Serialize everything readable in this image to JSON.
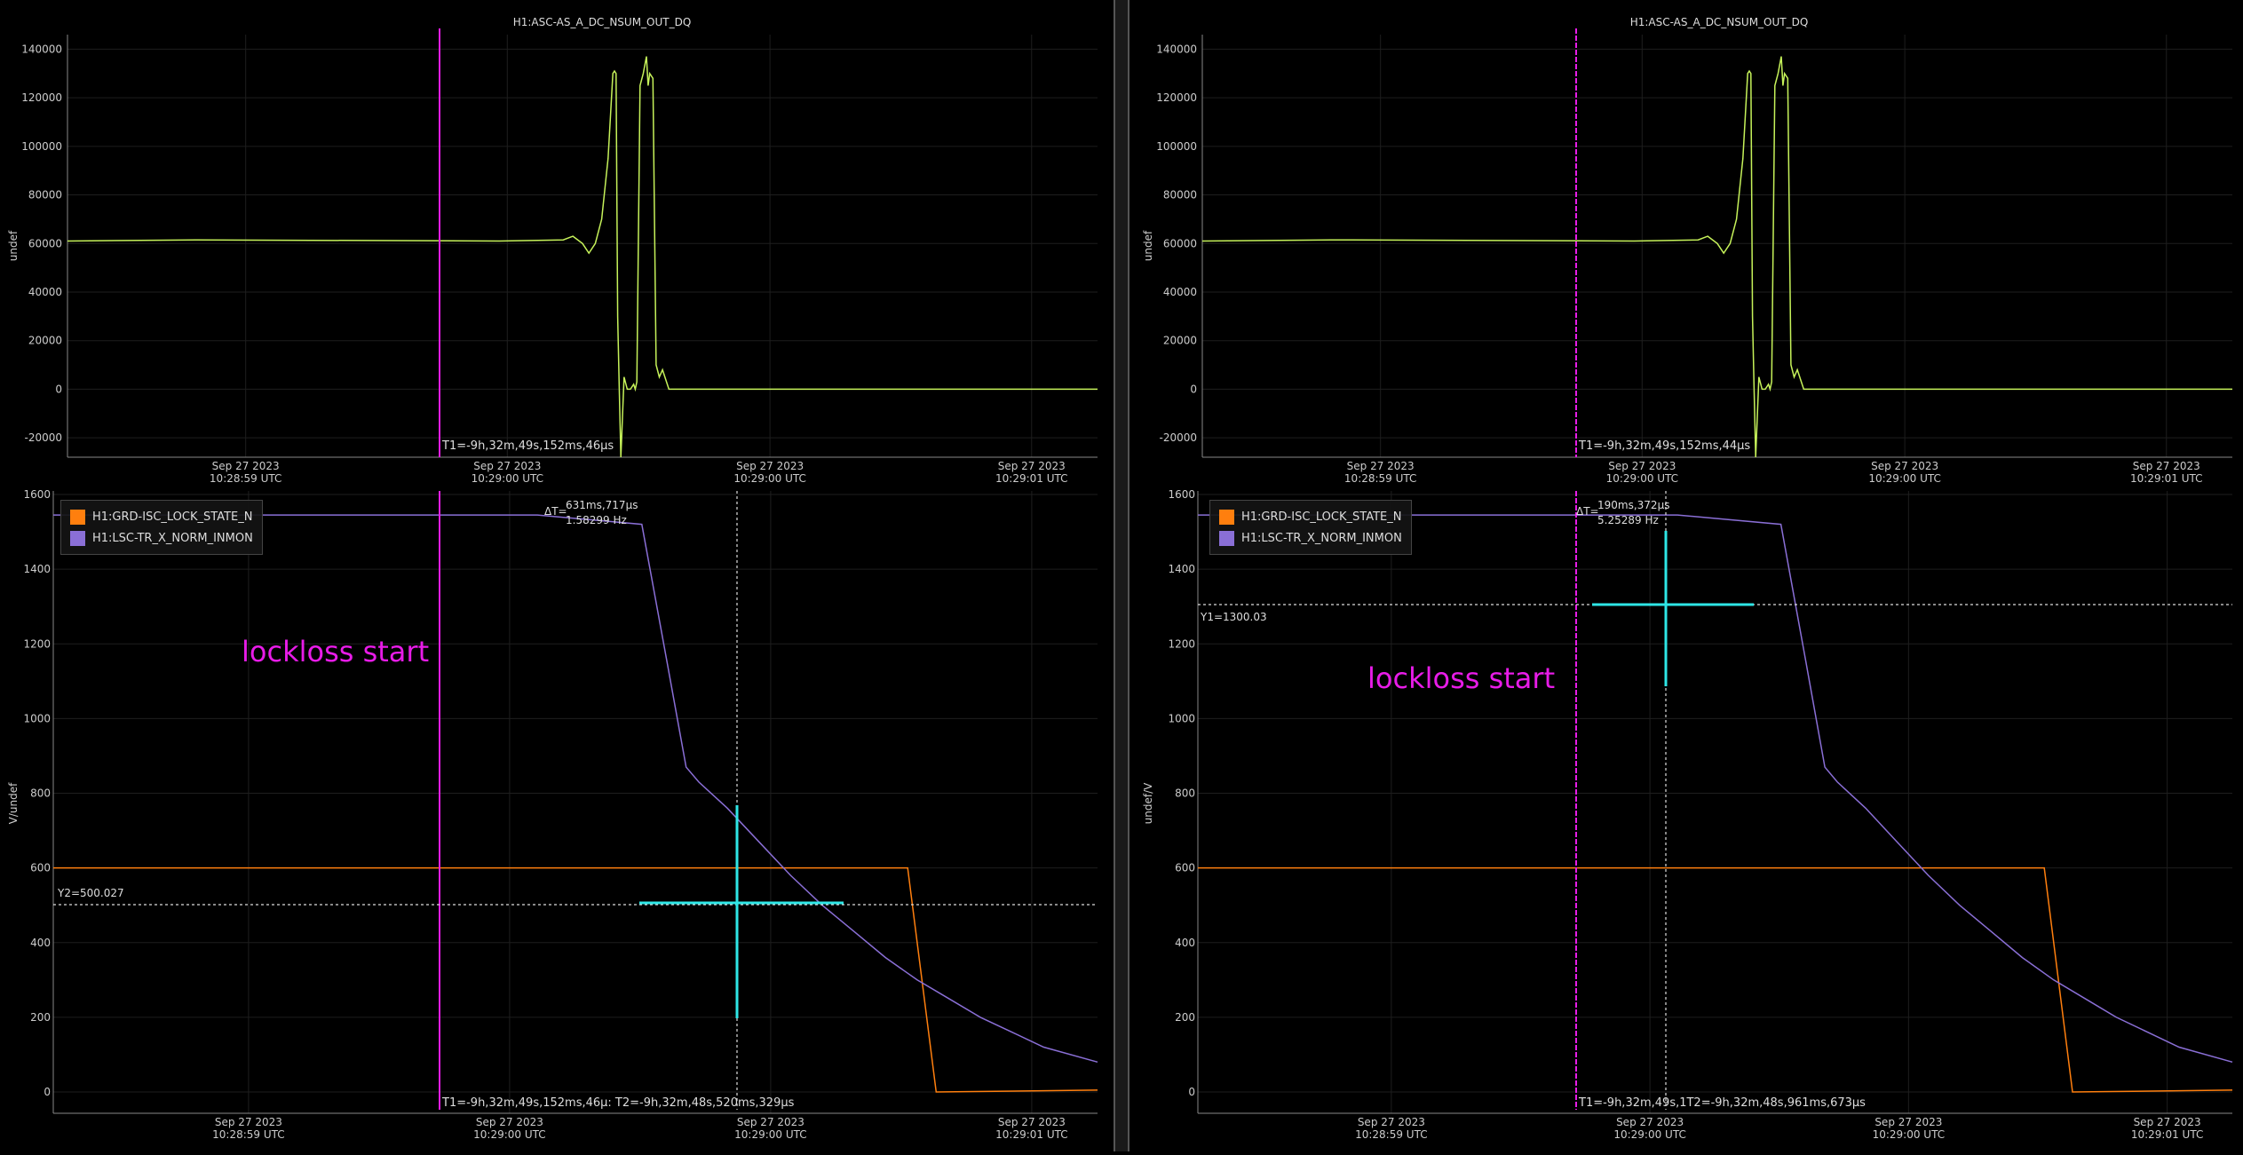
{
  "colors": {
    "green": "#c6f25a",
    "orange": "#ff7f0e",
    "purple": "#8a6fd6",
    "magenta": "#e81ce8",
    "cyan": "#2ee6e6",
    "cursor": "#dddddd"
  },
  "panels": [
    {
      "id": "left",
      "top": {
        "title": "H1:ASC-AS_A_DC_NSUM_OUT_DQ",
        "ylabel": "undef",
        "y_ticks": [
          "140000",
          "120000",
          "100000",
          "80000",
          "60000",
          "40000",
          "20000",
          "0",
          "-20000"
        ],
        "x_ticks": [
          {
            "date": "Sep 27 2023",
            "time": "10:28:59 UTC"
          },
          {
            "date": "Sep 27 2023",
            "time": "10:29:00 UTC"
          },
          {
            "date": "Sep 27 2023",
            "time": "10:29:00 UTC"
          },
          {
            "date": "Sep 27 2023",
            "time": "10:29:01 UTC"
          }
        ],
        "t1_label": "T1=-9h,32m,49s,152ms,46μs"
      },
      "bottom": {
        "ylabel": "V/undef",
        "y_ticks": [
          "1600",
          "1400",
          "1200",
          "1000",
          "800",
          "600",
          "400",
          "200",
          "0"
        ],
        "x_ticks": [
          {
            "date": "Sep 27 2023",
            "time": "10:28:59 UTC"
          },
          {
            "date": "Sep 27 2023",
            "time": "10:29:00 UTC"
          },
          {
            "date": "Sep 27 2023",
            "time": "10:29:00 UTC"
          },
          {
            "date": "Sep 27 2023",
            "time": "10:29:01 UTC"
          }
        ],
        "legend": [
          "H1:GRD-ISC_LOCK_STATE_N",
          "H1:LSC-TR_X_NORM_INMON"
        ],
        "annotation": "lockloss start",
        "delta_label": "ΔT=",
        "delta_t": "631ms,717μs",
        "delta_hz": "1.58299 Hz",
        "y_cursor_label": "Y2=500.027",
        "cursor_label": "T1=-9h,32m,49s,152ms,46μ: T2=-9h,32m,48s,520ms,329μs"
      }
    },
    {
      "id": "right",
      "top": {
        "title": "H1:ASC-AS_A_DC_NSUM_OUT_DQ",
        "ylabel": "undef",
        "y_ticks": [
          "140000",
          "120000",
          "100000",
          "80000",
          "60000",
          "40000",
          "20000",
          "0",
          "-20000"
        ],
        "x_ticks": [
          {
            "date": "Sep 27 2023",
            "time": "10:28:59 UTC"
          },
          {
            "date": "Sep 27 2023",
            "time": "10:29:00 UTC"
          },
          {
            "date": "Sep 27 2023",
            "time": "10:29:00 UTC"
          },
          {
            "date": "Sep 27 2023",
            "time": "10:29:01 UTC"
          }
        ],
        "t1_label": "T1=-9h,32m,49s,152ms,44μs"
      },
      "bottom": {
        "ylabel": "undef/V",
        "y_ticks": [
          "1600",
          "1400",
          "1200",
          "1000",
          "800",
          "600",
          "400",
          "200",
          "0"
        ],
        "x_ticks": [
          {
            "date": "Sep 27 2023",
            "time": "10:28:59 UTC"
          },
          {
            "date": "Sep 27 2023",
            "time": "10:29:00 UTC"
          },
          {
            "date": "Sep 27 2023",
            "time": "10:29:00 UTC"
          },
          {
            "date": "Sep 27 2023",
            "time": "10:29:01 UTC"
          }
        ],
        "legend": [
          "H1:GRD-ISC_LOCK_STATE_N",
          "H1:LSC-TR_X_NORM_INMON"
        ],
        "annotation": "lockloss start",
        "delta_label": "ΔT=",
        "delta_t": "190ms,372μs",
        "delta_hz": "5.25289 Hz",
        "y_cursor_label": "Y1=1300.03",
        "cursor_label": "T1=-9h,32m,49s,1T2=-9h,32m,48s,961ms,673μs"
      }
    }
  ],
  "chart_data": [
    {
      "type": "line",
      "panel": "left-top",
      "title": "H1:ASC-AS_A_DC_NSUM_OUT_DQ",
      "ylabel": "undef",
      "ylim": [
        -28000,
        146000
      ],
      "x_range_s": [
        -1.55,
        1.67
      ],
      "series": [
        {
          "name": "H1:ASC-AS_A_DC_NSUM_OUT_DQ",
          "x": [
            -1.55,
            -1.15,
            -0.2,
            0.0,
            0.03,
            0.06,
            0.08,
            0.1,
            0.12,
            0.14,
            0.155,
            0.16,
            0.165,
            0.17,
            0.175,
            0.18,
            0.19,
            0.2,
            0.21,
            0.22,
            0.225,
            0.23,
            0.24,
            0.25,
            0.26,
            0.265,
            0.27,
            0.28,
            0.29,
            0.3,
            0.31,
            0.33,
            0.4,
            1.67
          ],
          "y": [
            61000,
            61500,
            61000,
            61500,
            63000,
            60000,
            56000,
            60000,
            70000,
            95000,
            130000,
            131000,
            130000,
            30000,
            0,
            -28000,
            5000,
            0,
            0,
            2000,
            0,
            3000,
            125000,
            130000,
            137000,
            125000,
            130000,
            128000,
            10000,
            5000,
            8000,
            0,
            0,
            0
          ]
        }
      ],
      "cursor_T1_s": 0.0
    },
    {
      "type": "line",
      "panel": "left-bottom",
      "ylabel": "V/undef",
      "ylim": [
        -60,
        1600
      ],
      "x_range_s": [
        -1.63,
        1.67
      ],
      "series": [
        {
          "name": "H1:GRD-ISC_LOCK_STATE_N",
          "x": [
            -1.63,
            1.07,
            1.16,
            1.67
          ],
          "y": [
            600,
            600,
            0,
            5
          ]
        },
        {
          "name": "H1:LSC-TR_X_NORM_INMON",
          "x": [
            -1.63,
            -0.1,
            0.23,
            0.31,
            0.37,
            0.41,
            0.5,
            0.6,
            0.7,
            0.8,
            0.9,
            1.0,
            1.1,
            1.2,
            1.3,
            1.4,
            1.5,
            1.67
          ],
          "y": [
            1545,
            1545,
            1520,
            1150,
            870,
            830,
            760,
            670,
            580,
            500,
            430,
            360,
            300,
            250,
            200,
            160,
            120,
            80
          ]
        }
      ],
      "cursor_T1_s": 0.0,
      "cursor_T2_s": 0.632,
      "y_cursor": 500.027,
      "delta_t": "631ms,717μs",
      "delta_hz": "1.58299 Hz"
    },
    {
      "type": "line",
      "panel": "right-top",
      "title": "H1:ASC-AS_A_DC_NSUM_OUT_DQ",
      "ylabel": "undef",
      "ylim": [
        -28000,
        146000
      ],
      "x_range_s": [
        -1.55,
        1.67
      ],
      "series": [
        {
          "name": "H1:ASC-AS_A_DC_NSUM_OUT_DQ",
          "x": [
            -1.55,
            -1.15,
            -0.2,
            0.0,
            0.03,
            0.06,
            0.08,
            0.1,
            0.12,
            0.14,
            0.155,
            0.16,
            0.165,
            0.17,
            0.175,
            0.18,
            0.19,
            0.2,
            0.21,
            0.22,
            0.225,
            0.23,
            0.24,
            0.25,
            0.26,
            0.265,
            0.27,
            0.28,
            0.29,
            0.3,
            0.31,
            0.33,
            0.4,
            1.67
          ],
          "y": [
            61000,
            61500,
            61000,
            61500,
            63000,
            60000,
            56000,
            60000,
            70000,
            95000,
            130000,
            131000,
            130000,
            30000,
            0,
            -28000,
            5000,
            0,
            0,
            2000,
            0,
            3000,
            125000,
            130000,
            137000,
            125000,
            130000,
            128000,
            10000,
            5000,
            8000,
            0,
            0,
            0
          ]
        }
      ],
      "cursor_T1_s": 0.0
    },
    {
      "type": "line",
      "panel": "right-bottom",
      "ylabel": "undef/V",
      "ylim": [
        -60,
        1600
      ],
      "x_range_s": [
        -1.63,
        1.67
      ],
      "series": [
        {
          "name": "H1:GRD-ISC_LOCK_STATE_N",
          "x": [
            -1.63,
            1.07,
            1.16,
            1.67
          ],
          "y": [
            600,
            600,
            0,
            5
          ]
        },
        {
          "name": "H1:LSC-TR_X_NORM_INMON",
          "x": [
            -1.63,
            -0.1,
            0.23,
            0.31,
            0.37,
            0.41,
            0.5,
            0.6,
            0.7,
            0.8,
            0.9,
            1.0,
            1.1,
            1.2,
            1.3,
            1.4,
            1.5,
            1.67
          ],
          "y": [
            1545,
            1545,
            1520,
            1150,
            870,
            830,
            760,
            670,
            580,
            500,
            430,
            360,
            300,
            250,
            200,
            160,
            120,
            80
          ]
        }
      ],
      "cursor_T1_s": 0.0,
      "cursor_T2_s": 0.19,
      "y_cursor": 1300.03,
      "delta_t": "190ms,372μs",
      "delta_hz": "5.25289 Hz"
    }
  ]
}
